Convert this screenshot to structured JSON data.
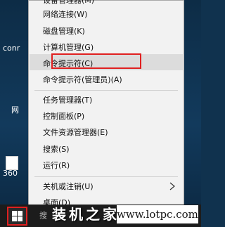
{
  "desktop": {
    "labels": [
      "conr",
      "网",
      "360"
    ]
  },
  "context_menu": {
    "items": [
      {
        "label": "设备管理器(M)"
      },
      {
        "label": "网络连接(W)"
      },
      {
        "label": "磁盘管理(K)"
      },
      {
        "label": "计算机管理(G)"
      },
      {
        "label": "命令提示符(C)"
      },
      {
        "label": "命令提示符(管理员)(A)"
      },
      {
        "label": "任务管理器(T)"
      },
      {
        "label": "控制面板(P)"
      },
      {
        "label": "文件资源管理器(E)"
      },
      {
        "label": "搜索(S)"
      },
      {
        "label": "运行(R)"
      },
      {
        "label": "关机或注销(U)"
      },
      {
        "label": "桌面(D)"
      }
    ],
    "highlighted_item": "命令提示符(C)",
    "highlight_color": "#e02020"
  },
  "taskbar": {
    "search_stub": "搜"
  },
  "watermark": {
    "chinese": "装机之家",
    "url": "www.lotpc.com"
  }
}
